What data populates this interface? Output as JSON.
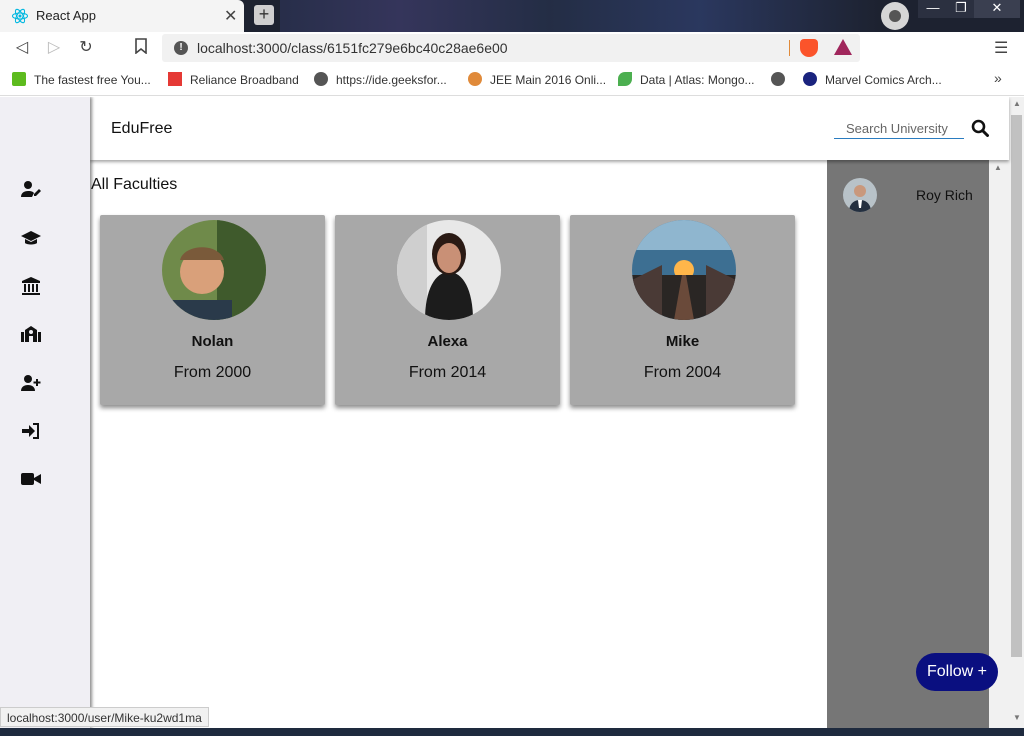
{
  "browser": {
    "tab_title": "React App",
    "tab_close": "✕",
    "new_tab": "+",
    "url": "localhost:3000/class/6151fc279e6bc40c28ae6e00",
    "window_controls": {
      "minimize": "—",
      "maximize": "❐",
      "close": "✕"
    },
    "bookmarks": [
      {
        "label": "The fastest free You...",
        "icon": "download-icon",
        "color": "#5dbb1e"
      },
      {
        "label": "Reliance Broadband",
        "icon": "reliance-logo-icon",
        "color": "#e53935"
      },
      {
        "label": "https://ide.geeksfor...",
        "icon": "globe-icon",
        "color": "#555555"
      },
      {
        "label": "JEE Main 2016 Onli...",
        "icon": "emblem-icon",
        "color": "#e08a3a"
      },
      {
        "label": "Data | Atlas: Mongo...",
        "icon": "leaf-icon",
        "color": "#4caf50"
      },
      {
        "label": "",
        "icon": "globe-icon",
        "color": "#555555"
      },
      {
        "label": "Marvel Comics Arch...",
        "icon": "jio-icon",
        "color": "#1a237e"
      }
    ],
    "status_url": "localhost:3000/user/Mike-ku2wd1ma"
  },
  "app": {
    "brand": "EduFree",
    "search": {
      "placeholder": "Search University",
      "value": ""
    },
    "sidebar_icons": [
      "user-edit-icon",
      "graduation-cap-icon",
      "university-icon",
      "school-icon",
      "user-plus-icon",
      "sign-in-icon",
      "video-icon"
    ],
    "section_title": "All Faculties",
    "faculties": [
      {
        "name": "Nolan",
        "since": "From 2000"
      },
      {
        "name": "Alexa",
        "since": "From 2014"
      },
      {
        "name": "Mike",
        "since": "From 2004"
      }
    ],
    "suggested_user": {
      "name": "Roy Rich"
    },
    "follow_label": "Follow +",
    "colors": {
      "card_bg": "#a8a8a8",
      "right_panel_bg": "#767676",
      "follow_bg": "#0a0f80",
      "search_underline": "#2a7cc0"
    }
  }
}
